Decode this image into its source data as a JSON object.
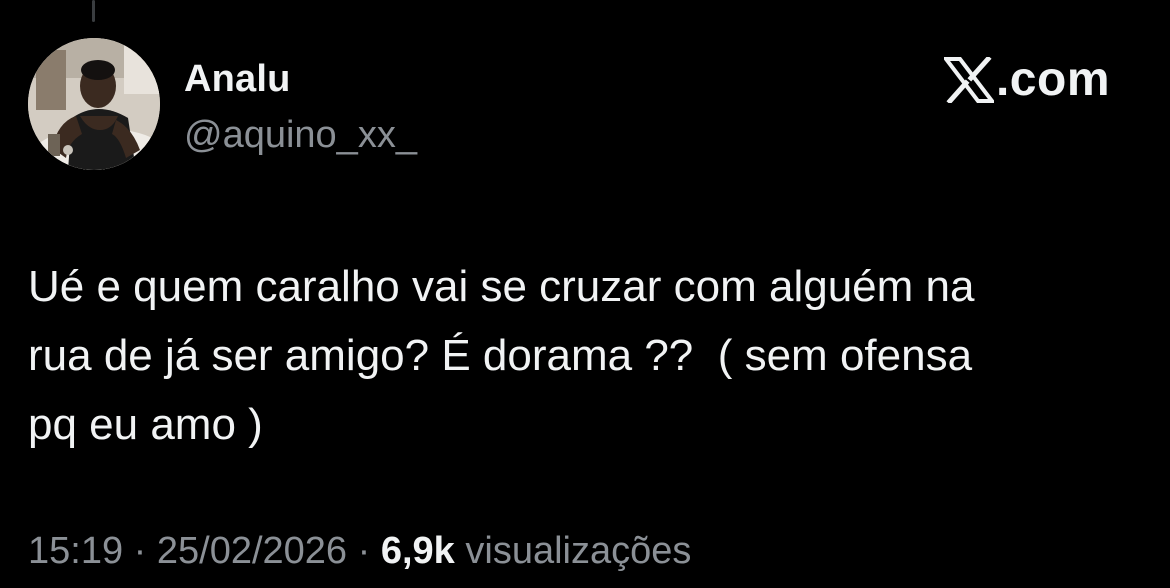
{
  "author": {
    "display_name": "Analu",
    "handle": "@aquino_xx_"
  },
  "brand": {
    "suffix": ".com",
    "logo_icon": "x-logo-icon"
  },
  "tweet": {
    "text": "Ué e quem caralho vai se cruzar com alguém na\nrua de já ser amigo? É dorama ??  ( sem ofensa\npq eu amo )"
  },
  "meta": {
    "time": "15:19",
    "separator": "·",
    "date": "25/02/2026",
    "views_count": "6,9k",
    "views_label": "visualizações"
  },
  "colors": {
    "background": "#000000",
    "primary_text": "#f1f3f4",
    "secondary_text": "#8b9096"
  }
}
